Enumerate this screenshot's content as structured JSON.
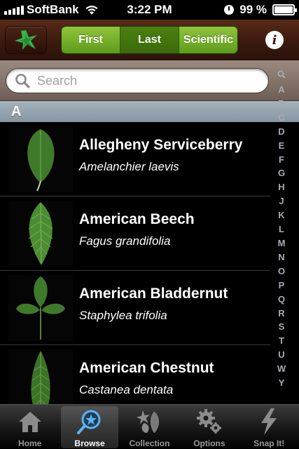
{
  "status_bar": {
    "carrier": "SoftBank",
    "time": "3:22 PM",
    "battery_label": "99 %",
    "battery_level": 0.99
  },
  "nav": {
    "segments": [
      {
        "label": "First",
        "selected": false
      },
      {
        "label": "Last",
        "selected": true
      },
      {
        "label": "Scientific",
        "selected": false
      }
    ],
    "info_label": "i"
  },
  "search": {
    "placeholder": "Search"
  },
  "section": {
    "letter": "A"
  },
  "species": [
    {
      "common": "Allegheny Serviceberry",
      "scientific": "Amelanchier laevis",
      "leaf": "oval"
    },
    {
      "common": "American Beech",
      "scientific": "Fagus grandifolia",
      "leaf": "elliptic"
    },
    {
      "common": "American Bladdernut",
      "scientific": "Staphylea trifolia",
      "leaf": "trifoliate"
    },
    {
      "common": "American Chestnut",
      "scientific": "Castanea dentata",
      "leaf": "lanceolate"
    }
  ],
  "index_letters": [
    "A",
    "B",
    "C",
    "D",
    "E",
    "F",
    "G",
    "H",
    "J",
    "K",
    "L",
    "M",
    "N",
    "O",
    "P",
    "Q",
    "R",
    "S",
    "T",
    "U",
    "W",
    "Y"
  ],
  "tabs": [
    {
      "label": "Home",
      "icon": "home-icon",
      "active": false
    },
    {
      "label": "Browse",
      "icon": "browse-icon",
      "active": true
    },
    {
      "label": "Collection",
      "icon": "collection-icon",
      "active": false
    },
    {
      "label": "Options",
      "icon": "gears-icon",
      "active": false
    },
    {
      "label": "Snap It!",
      "icon": "lightning-icon",
      "active": false
    }
  ],
  "colors": {
    "nav_brown": "#3b1a0f",
    "segment_green": "#6fae22",
    "segment_selected": "#4c8010",
    "section_header": "#95a3ae",
    "leaf_green": "#3f7a2a"
  }
}
